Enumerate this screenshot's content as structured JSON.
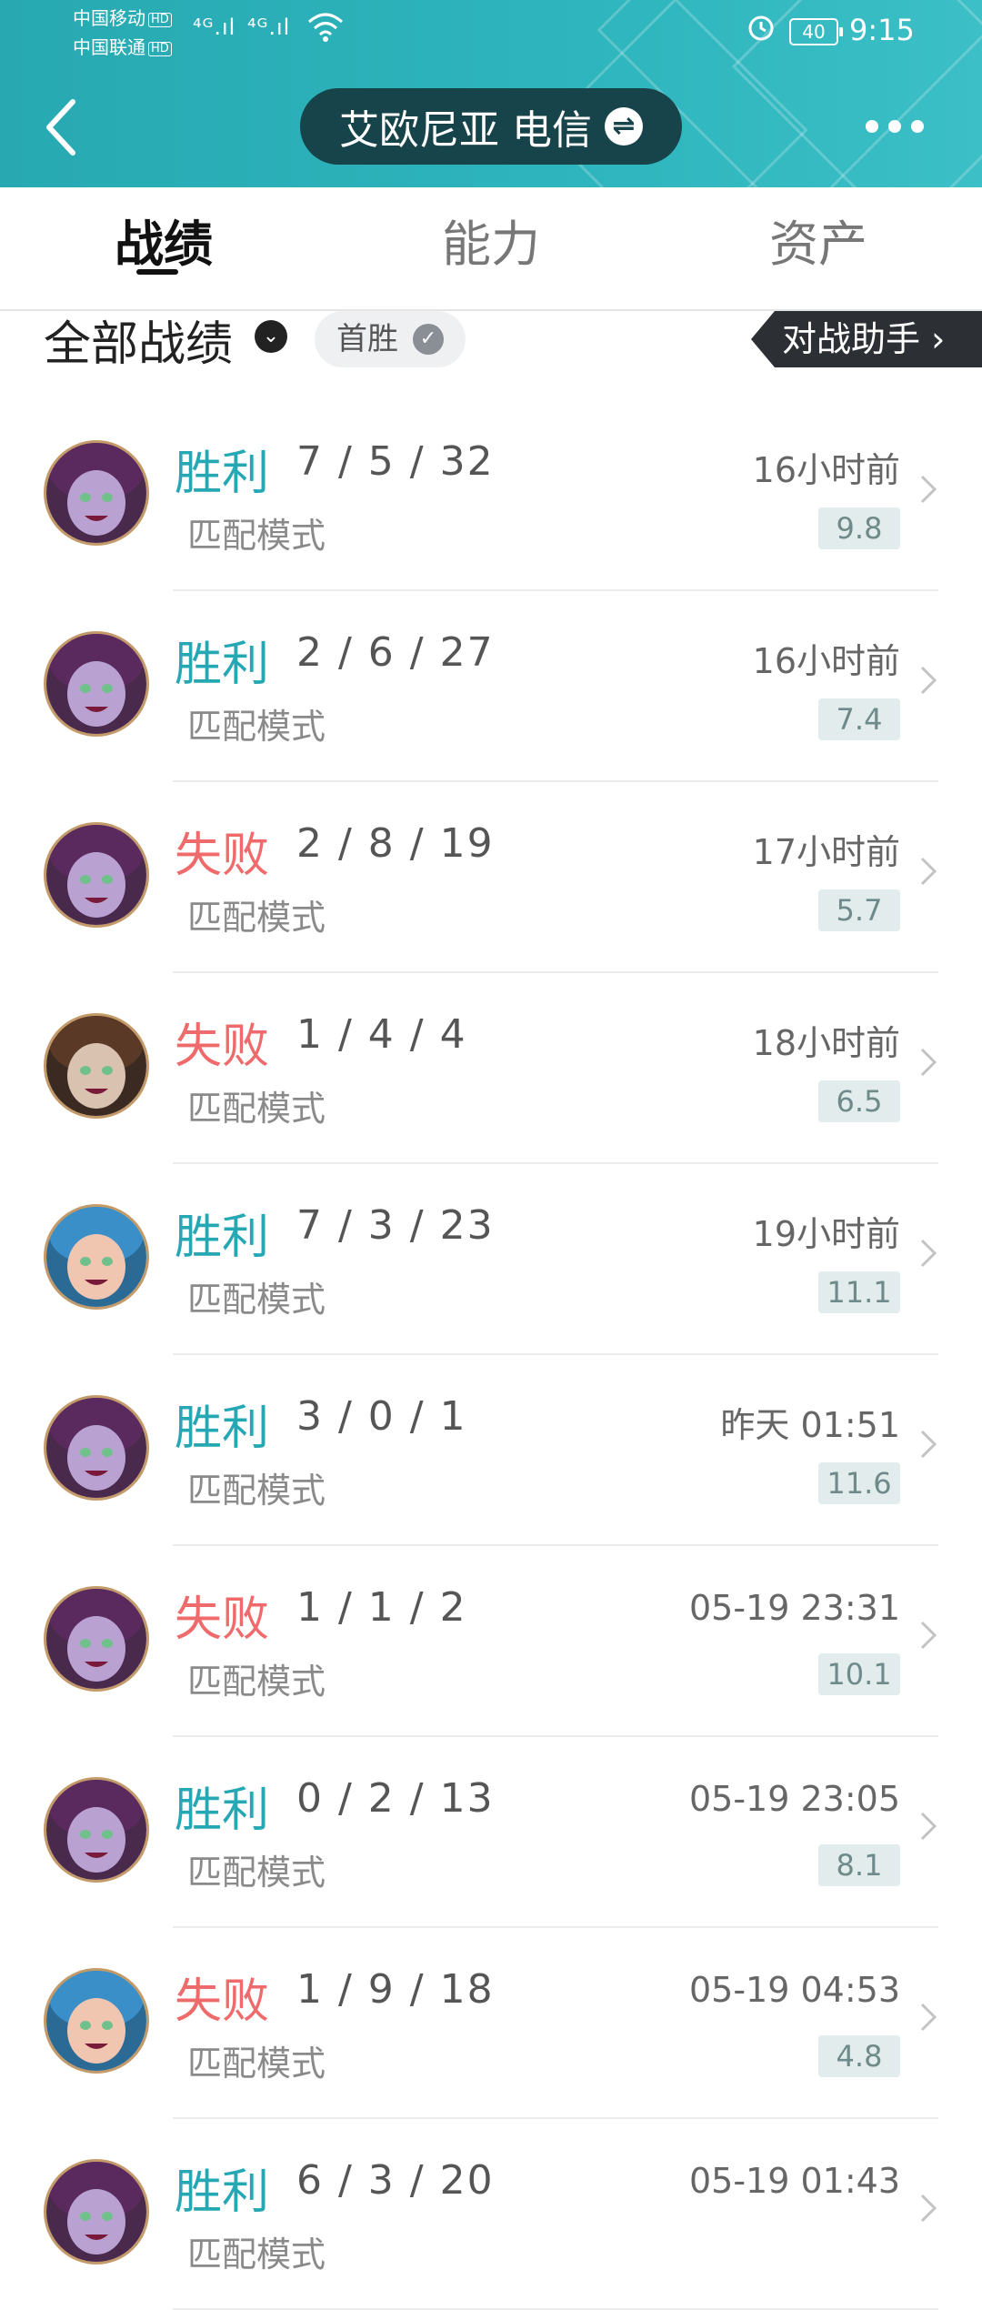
{
  "status_bar": {
    "carrier1": "中国移动",
    "carrier2": "中国联通",
    "hd": "HD",
    "net1": "⁴ᴳ.ıl",
    "net2": "⁴ᴳ.ıl",
    "battery": "40",
    "time": "9:15"
  },
  "header": {
    "server": "艾欧尼亚 电信",
    "swap_glyph": "⇌",
    "back_icon": "chevron-left-icon",
    "more_icon": "more-dots-icon"
  },
  "tabs": [
    "战绩",
    "能力",
    "资产"
  ],
  "filter": {
    "title": "全部战绩",
    "dropdown_glyph": "⌄",
    "chip": "首胜",
    "chip_check": "✓",
    "assistant": "对战助手 ›"
  },
  "matches": [
    {
      "result": "胜利",
      "kda": "7 / 5 / 32",
      "mode": "匹配模式",
      "time": "16小时前",
      "score": "9.8"
    },
    {
      "result": "胜利",
      "kda": "2 / 6 / 27",
      "mode": "匹配模式",
      "time": "16小时前",
      "score": "7.4"
    },
    {
      "result": "失败",
      "kda": "2 / 8 / 19",
      "mode": "匹配模式",
      "time": "17小时前",
      "score": "5.7"
    },
    {
      "result": "失败",
      "kda": "1 / 4 / 4",
      "mode": "匹配模式",
      "time": "18小时前",
      "score": "6.5"
    },
    {
      "result": "胜利",
      "kda": "7 / 3 / 23",
      "mode": "匹配模式",
      "time": "19小时前",
      "score": "11.1"
    },
    {
      "result": "胜利",
      "kda": "3 / 0 / 1",
      "mode": "匹配模式",
      "time": "昨天 01:51",
      "score": "11.6"
    },
    {
      "result": "失败",
      "kda": "1 / 1 / 2",
      "mode": "匹配模式",
      "time": "05-19 23:31",
      "score": "10.1"
    },
    {
      "result": "胜利",
      "kda": "0 / 2 / 13",
      "mode": "匹配模式",
      "time": "05-19 23:05",
      "score": "8.1"
    },
    {
      "result": "失败",
      "kda": "1 / 9 / 18",
      "mode": "匹配模式",
      "time": "05-19 04:53",
      "score": "4.8"
    },
    {
      "result": "胜利",
      "kda": "6 / 3 / 20",
      "mode": "匹配模式",
      "time": "05-19 01:43",
      "score": ""
    }
  ],
  "colors": {
    "header_bg": "#2eb5bd",
    "win": "#25a8b4",
    "loss": "#ef6a6a",
    "pill_bg": "#17444a"
  }
}
